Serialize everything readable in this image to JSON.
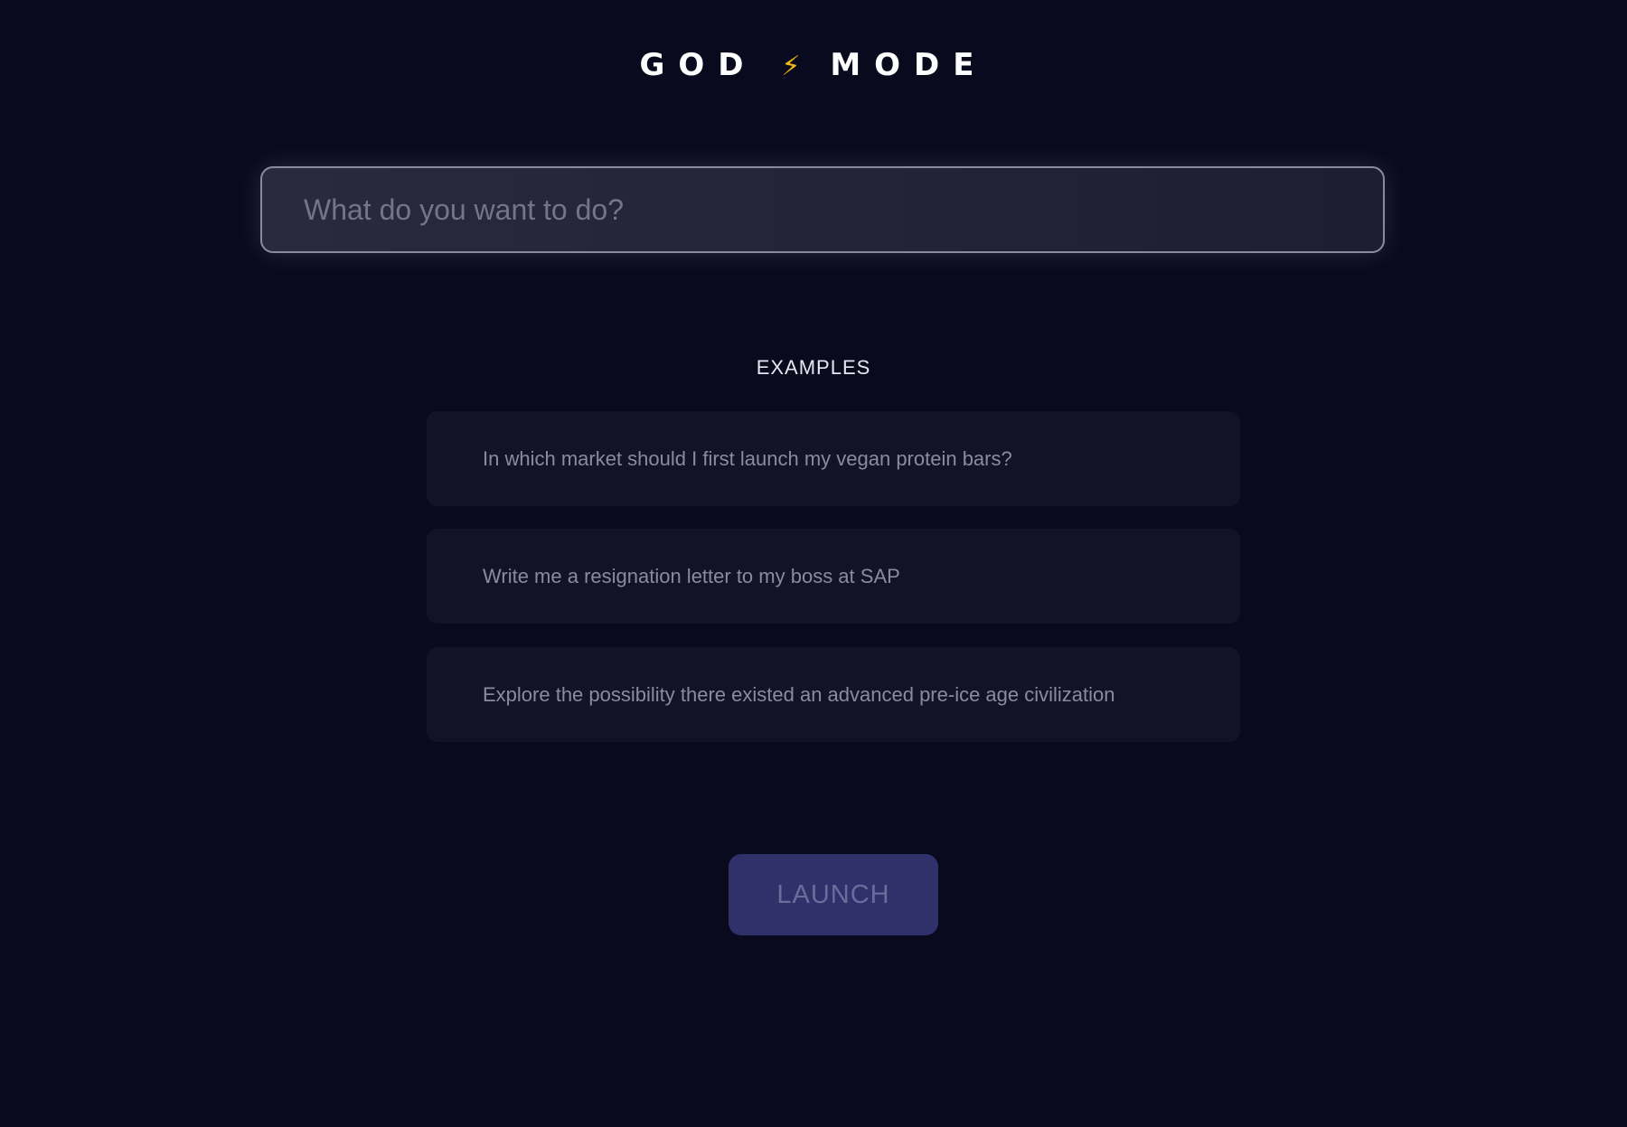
{
  "header": {
    "title_left": "GOD",
    "title_icon": "lightning-bolt-icon",
    "title_right": "MODE",
    "bolt_glyph": "⚡",
    "bolt_color": "#f5b619"
  },
  "search": {
    "placeholder": "What do you want to do?",
    "value": ""
  },
  "examples": {
    "heading": "EXAMPLES",
    "items": [
      "In which market should I first launch my vegan protein bars?",
      "Write me a resignation letter to my boss at SAP",
      "Explore the possibility there existed an advanced pre-ice age civilization"
    ]
  },
  "launch": {
    "label": "LAUNCH"
  },
  "colors": {
    "background": "#0a0a1f",
    "card": "#131326",
    "button": "#30306b"
  }
}
